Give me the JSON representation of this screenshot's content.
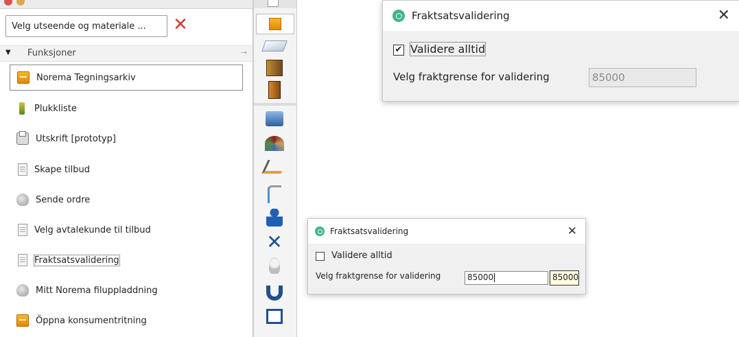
{
  "left_panel": {
    "appearance_field": "Velg utseende og materiale ...",
    "clear_icon": "close-x-red",
    "funksjoner_label": "Funksjoner",
    "items": [
      {
        "label": "Norema Tegningsarkiv",
        "icon": "archive-icon",
        "selected": true
      },
      {
        "label": "Plukkliste",
        "icon": "picklist-icon"
      },
      {
        "label": "Utskrift [prototyp]",
        "icon": "printer-icon"
      },
      {
        "label": "Skape tilbud",
        "icon": "document-icon"
      },
      {
        "label": "Sende ordre",
        "icon": "shell-icon"
      },
      {
        "label": "Velg avtalekunde til tilbud",
        "icon": "document-icon"
      },
      {
        "label": "Fraktsatsvalidering",
        "icon": "document-icon",
        "focused": true
      },
      {
        "label": "Mitt Norema filuppladdning",
        "icon": "shell-icon"
      },
      {
        "label": "Öppna konsumentritning",
        "icon": "archive-icon"
      }
    ]
  },
  "toolbar": {
    "icons": [
      "archive-icon",
      "countertop-icon",
      "cabinet-icon",
      "door-panel-icon",
      "house-icon",
      "color-swatch-icon",
      "measure-icon",
      "plumbing-icon",
      "people-icon",
      "tools-icon",
      "lightbulb-icon",
      "magnet-icon",
      "home-icon"
    ]
  },
  "dialog_large": {
    "title": "Fraktsatsvalidering",
    "checkbox_label": "Validere alltid",
    "checked": true,
    "field_label": "Velg fraktgrense for validering",
    "field_value": "85000",
    "field_disabled": true
  },
  "dialog_small": {
    "title": "Fraktsatsvalidering",
    "checkbox_label": "Validere alltid",
    "checked": false,
    "field_label": "Velg fraktgrense for validering",
    "field_value": "85000",
    "tooltip_value": "85000"
  },
  "colors": {
    "accent_green": "#3fb38a",
    "clear_red": "#d23a3a",
    "archive_orange": "#f0a020"
  }
}
